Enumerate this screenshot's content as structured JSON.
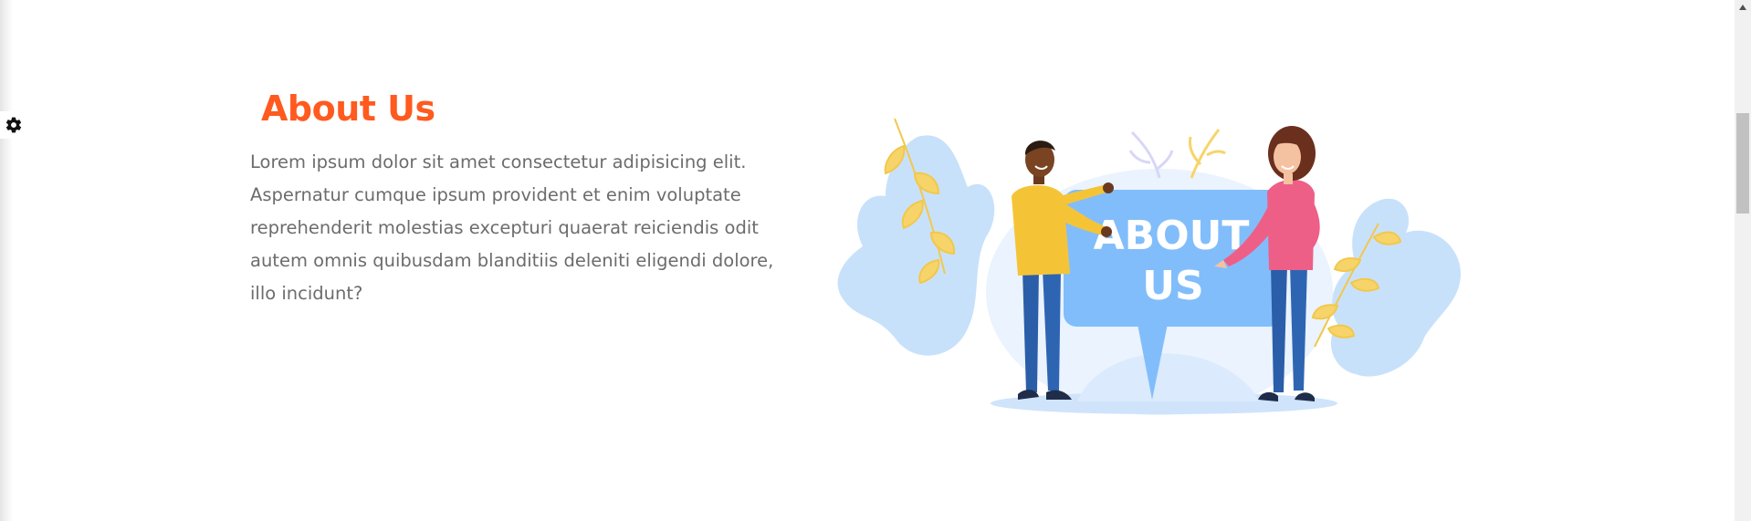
{
  "settings": {
    "icon": "gear-icon"
  },
  "about": {
    "title": "About Us",
    "paragraph": "Lorem ipsum dolor sit amet consectetur adipisicing elit. Aspernatur cumque ipsum provident et enim voluptate reprehenderit molestias excepturi quaerat reiciendis odit autem omnis quibusdam blanditiis deleniti eligendi dolore, illo incidunt?"
  },
  "illustration": {
    "sign_line1": "ABOUT",
    "sign_line2": "US"
  },
  "colors": {
    "accent": "#ff5a1f",
    "body_text": "#6c6c6c",
    "sign_blue": "#82bdfb"
  }
}
